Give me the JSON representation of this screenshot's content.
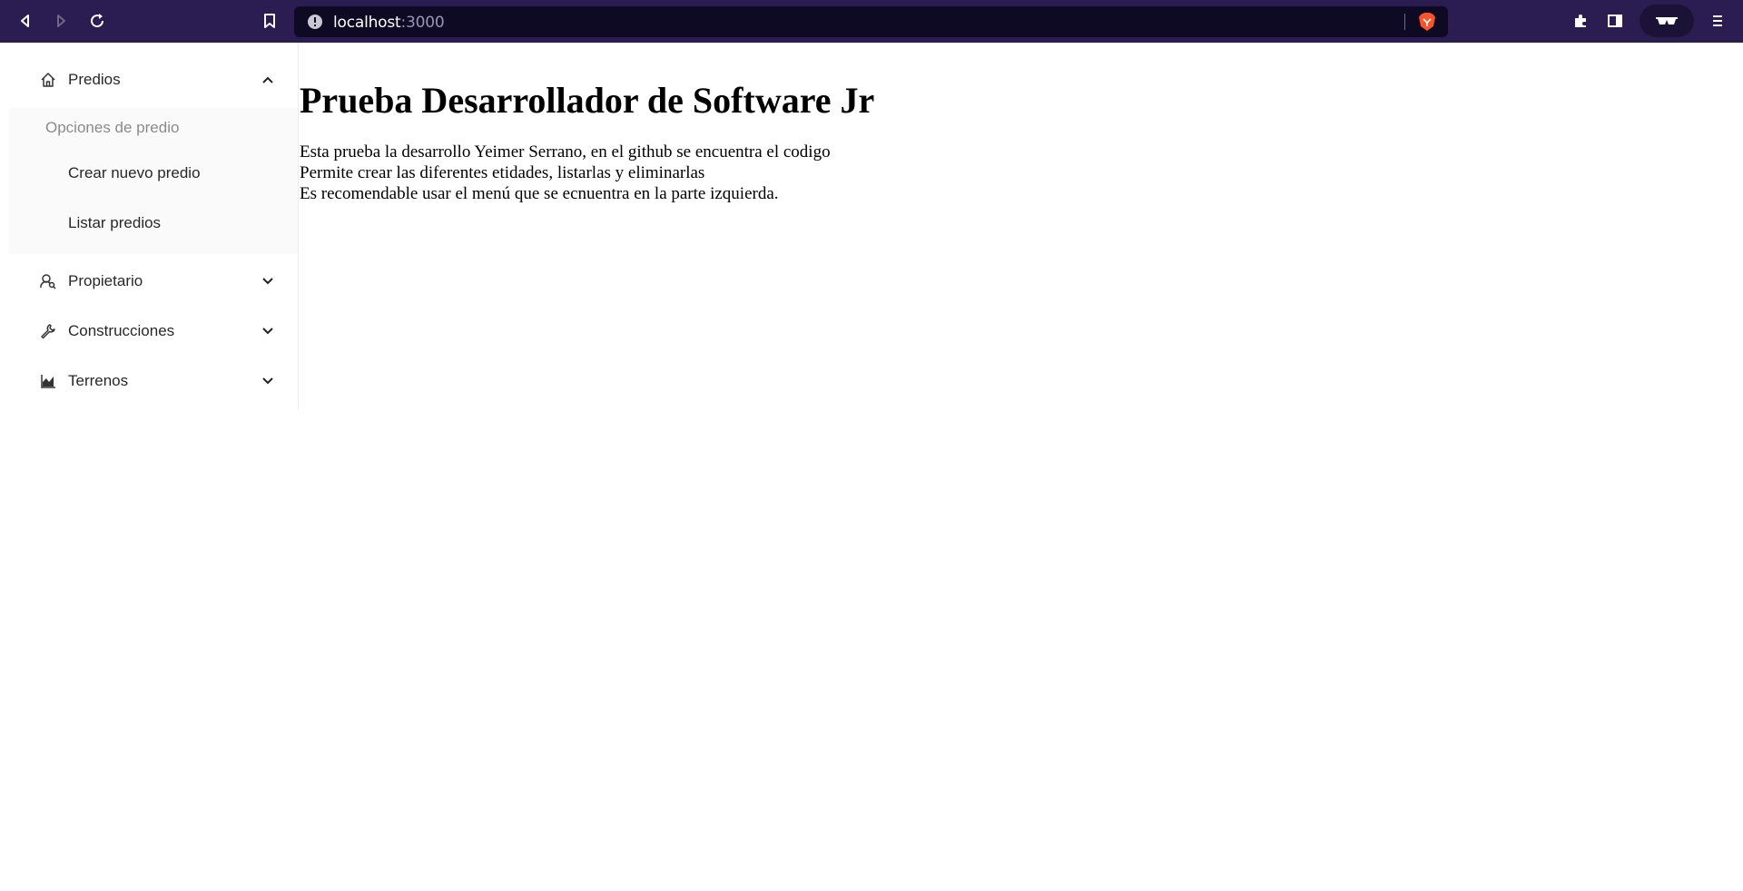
{
  "browser": {
    "url_host": "localhost",
    "url_port": ":3000"
  },
  "sidebar": {
    "items": [
      {
        "label": "Predios",
        "icon": "home-icon",
        "expanded": true
      },
      {
        "label": "Propietario",
        "icon": "user-search-icon",
        "expanded": false
      },
      {
        "label": "Construcciones",
        "icon": "wrench-icon",
        "expanded": false
      },
      {
        "label": "Terrenos",
        "icon": "area-chart-icon",
        "expanded": false
      }
    ],
    "predios_submenu": {
      "group_title": "Opciones de predio",
      "items": [
        {
          "label": "Crear nuevo predio"
        },
        {
          "label": "Listar predios"
        }
      ]
    }
  },
  "main": {
    "title": "Prueba Desarrollador de Software Jr",
    "lines": [
      "Esta prueba la desarrollo Yeimer Serrano, en el github se encuentra el codigo",
      "Permite crear las diferentes etidades, listarlas y eliminarlas",
      "Es recomendable usar el menú que se ecnuentra en la parte izquierda."
    ]
  },
  "colors": {
    "toolbar_bg": "#2b1d52",
    "urlbar_bg": "#0e0a23",
    "submenu_bg": "#fafafa",
    "brave_orange": "#fb542b"
  }
}
